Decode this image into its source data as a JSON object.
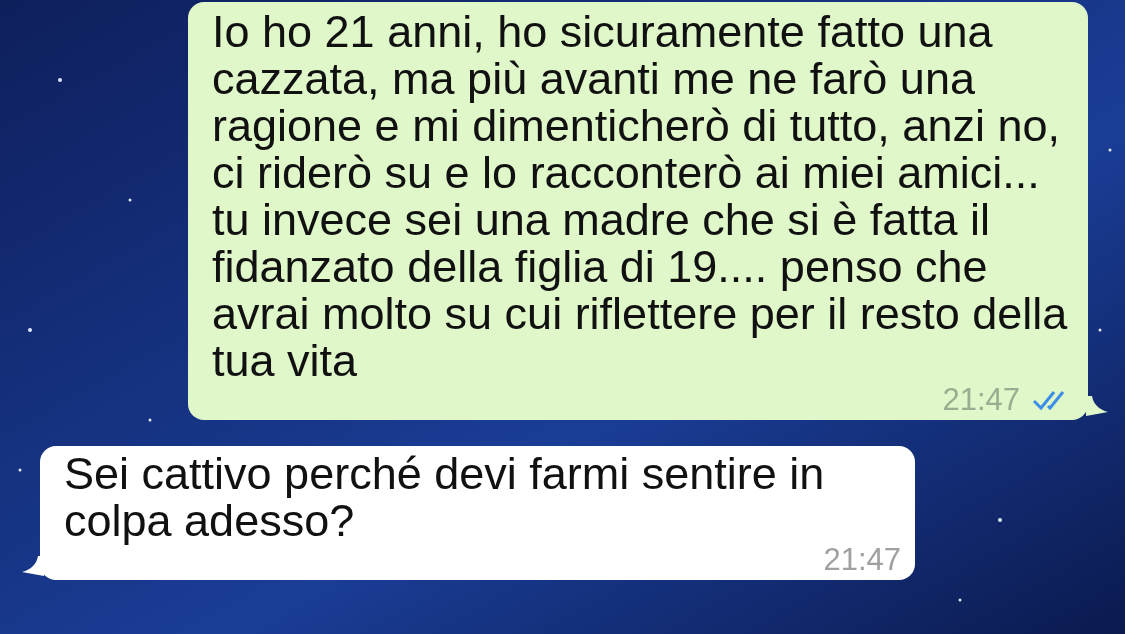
{
  "messages": [
    {
      "kind": "outgoing",
      "text": "Io ho 21 anni, ho sicuramente fatto una cazzata, ma più avanti me ne farò una ragione e mi dimenticherò di tutto, anzi no, ci riderò su e lo racconterò ai miei amici... tu invece sei una madre che si è fatta il fidanzato della figlia di 19.... penso che avrai molto su cui riflettere per il resto della tua vita",
      "time": "21:47",
      "read": true
    },
    {
      "kind": "incoming",
      "text": "Sei cattivo perché devi farmi sentire in colpa adesso?",
      "time": "21:47"
    }
  ]
}
